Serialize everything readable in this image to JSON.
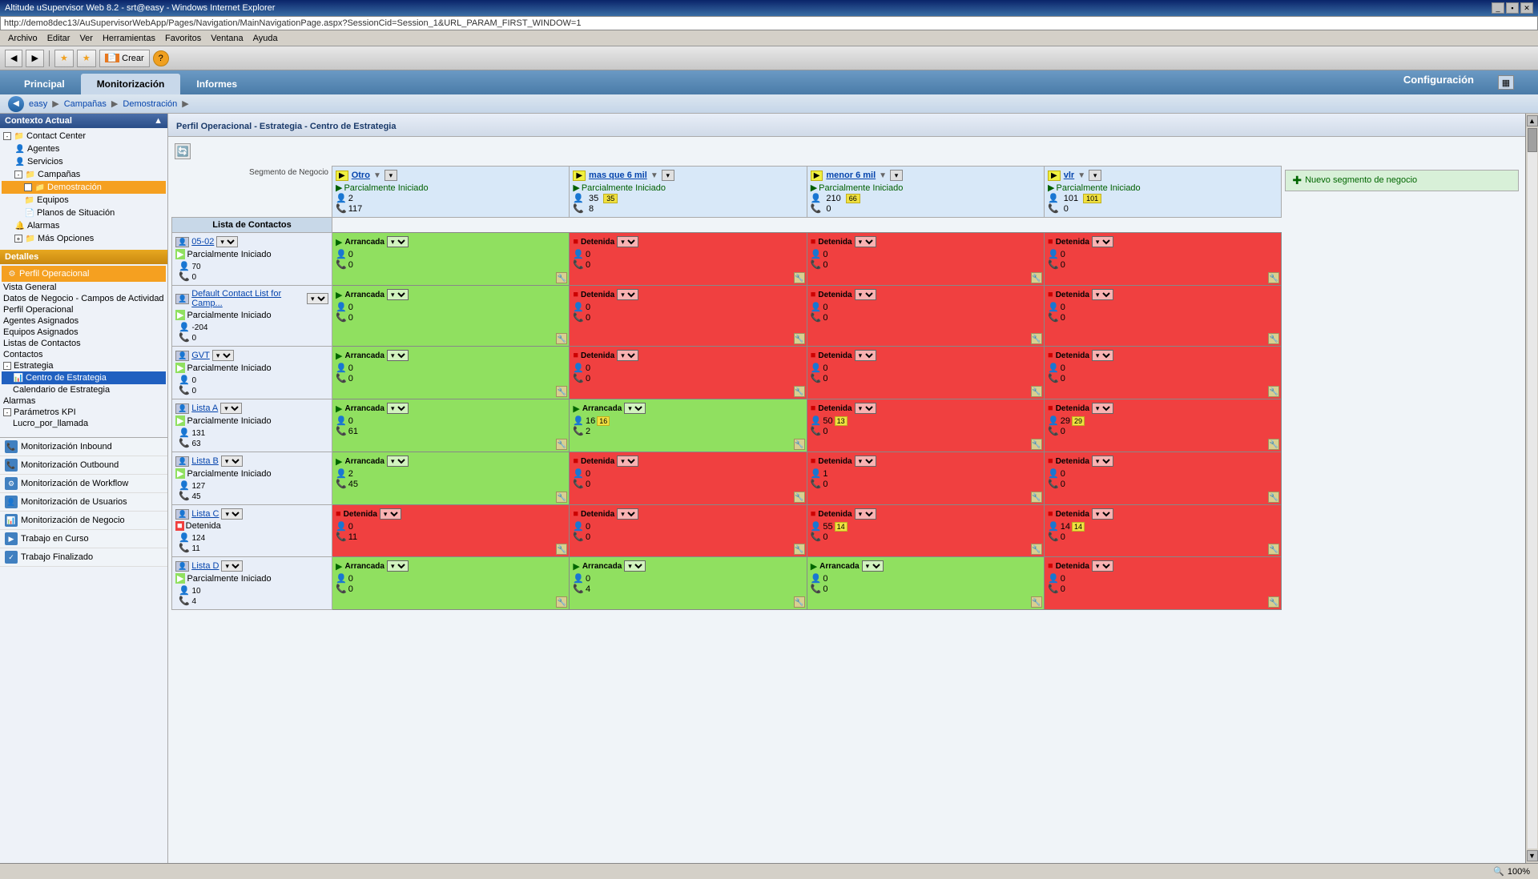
{
  "window": {
    "title": "Altitude uSupervisor Web 8.2 - srt@easy - Windows Internet Explorer",
    "url": "http://demo8dec13/AuSupervisorWebApp/Pages/Navigation/MainNavigationPage.aspx?SessionCid=Session_1&URL_PARAM_FIRST_WINDOW=1"
  },
  "menubar": {
    "items": [
      "Archivo",
      "Editar",
      "Ver",
      "Herramientas",
      "Favoritos",
      "Ventana",
      "Ayuda"
    ]
  },
  "toolbar": {
    "back_label": "◀",
    "forward_label": "▶",
    "star1": "★",
    "star2": "★",
    "create_label": "Crear"
  },
  "navtabs": {
    "tabs": [
      "Principal",
      "Monitorización",
      "Informes"
    ],
    "active": "Monitorización",
    "config_label": "Configuración"
  },
  "breadcrumb": {
    "items": [
      "easy",
      "Campañas",
      "Demostración"
    ]
  },
  "sidebar": {
    "contexto_label": "Contexto Actual",
    "tree": [
      {
        "label": "Contact Center",
        "level": 0,
        "icon": "folder",
        "expanded": true
      },
      {
        "label": "Agentes",
        "level": 1,
        "icon": "person"
      },
      {
        "label": "Servicios",
        "level": 1,
        "icon": "person"
      },
      {
        "label": "Campañas",
        "level": 1,
        "icon": "folder",
        "expanded": true
      },
      {
        "label": "Demostración",
        "level": 2,
        "icon": "folder",
        "selected": true
      },
      {
        "label": "Equipos",
        "level": 2,
        "icon": "folder"
      },
      {
        "label": "Planos de Situación",
        "level": 2,
        "icon": "doc"
      },
      {
        "label": "Alarmas",
        "level": 1,
        "icon": "alarm"
      },
      {
        "label": "Más Opciones",
        "level": 1,
        "icon": "folder"
      }
    ],
    "detalles_label": "Detalles",
    "detalles_items": [
      {
        "label": "Perfil Operacional",
        "selected": true
      },
      {
        "label": "Vista General"
      },
      {
        "label": "Datos de Negocio - Campos de Actividad"
      },
      {
        "label": "Perfil Operacional"
      },
      {
        "label": "Agentes Asignados"
      },
      {
        "label": "Equipos Asignados"
      },
      {
        "label": "Listas de Contactos"
      },
      {
        "label": "Contactos"
      },
      {
        "label": "Estrategia",
        "expanded": true
      },
      {
        "label": "Centro de Estrategia",
        "level": 1,
        "selected_blue": true
      },
      {
        "label": "Calendario de Estrategia",
        "level": 1
      },
      {
        "label": "Alarmas"
      },
      {
        "label": "Parámetros KPI",
        "expanded": true
      },
      {
        "label": "Lucro_por_llamada",
        "level": 1
      }
    ],
    "bottom_btns": [
      {
        "label": "Monitorización Inbound",
        "color": "#4080c0"
      },
      {
        "label": "Monitorización Outbound",
        "color": "#4080c0"
      },
      {
        "label": "Monitorización de Workflow",
        "color": "#4080c0"
      },
      {
        "label": "Monitorización de Usuarios",
        "color": "#4080c0"
      },
      {
        "label": "Monitorización de Negocio",
        "color": "#4080c0"
      },
      {
        "label": "Trabajo en Curso",
        "color": "#4080c0"
      },
      {
        "label": "Trabajo Finalizado",
        "color": "#4080c0"
      }
    ]
  },
  "content": {
    "title": "Perfil Operacional - Estrategia - Centro de Estrategia",
    "segment_label": "Segmento de Negocio",
    "contact_list_label": "Lista de Contactos",
    "new_segment_label": "Nuevo segmento de negocio",
    "segments": [
      {
        "name": "Otro",
        "stats": {
          "partially": "Parcialmente Iniciado",
          "v1": "2",
          "v2": "117"
        }
      },
      {
        "name": "mas que 6 mil",
        "stats": {
          "partially": "Parcialmente Iniciado",
          "v1": "35",
          "badge": "35",
          "v2": "8"
        }
      },
      {
        "name": "menor 6 mil",
        "stats": {
          "partially": "Parcialmente Iniciado",
          "v1": "210",
          "badge": "66",
          "v2": "0"
        }
      },
      {
        "name": "vlr",
        "stats": {
          "partially": "Parcialmente Iniciado",
          "v1": "101",
          "badge": "101",
          "v2": "0"
        }
      }
    ],
    "contact_lists": [
      {
        "name": "05-02",
        "status_label": "Parcialmente Iniciado",
        "stats": {
          "v1": "70",
          "v2": "0"
        },
        "cells": [
          {
            "status": "Arrancada",
            "color": "green",
            "v1": "0",
            "v2": "0"
          },
          {
            "status": "Detenida",
            "color": "red",
            "v1": "0",
            "v2": "0"
          },
          {
            "status": "Detenida",
            "color": "red",
            "v1": "0",
            "v2": "0"
          },
          {
            "status": "Detenida",
            "color": "red",
            "v1": "0",
            "v2": "0"
          }
        ]
      },
      {
        "name": "Default Contact List for Camp...",
        "status_label": "Parcialmente Iniciado",
        "stats": {
          "v1": "-204",
          "v2": "0"
        },
        "cells": [
          {
            "status": "Arrancada",
            "color": "green",
            "v1": "0",
            "v2": "0"
          },
          {
            "status": "Detenida",
            "color": "red",
            "v1": "0",
            "v2": "0"
          },
          {
            "status": "Detenida",
            "color": "red",
            "v1": "0",
            "v2": "0"
          },
          {
            "status": "Detenida",
            "color": "red",
            "v1": "0",
            "v2": "0"
          }
        ]
      },
      {
        "name": "GVT",
        "status_label": "Parcialmente Iniciado",
        "stats": {
          "v1": "0",
          "v2": "0"
        },
        "cells": [
          {
            "status": "Arrancada",
            "color": "green",
            "v1": "0",
            "v2": "0"
          },
          {
            "status": "Detenida",
            "color": "red",
            "v1": "0",
            "v2": "0"
          },
          {
            "status": "Detenida",
            "color": "red",
            "v1": "0",
            "v2": "0"
          },
          {
            "status": "Detenida",
            "color": "red",
            "v1": "0",
            "v2": "0"
          }
        ]
      },
      {
        "name": "Lista A",
        "status_label": "Parcialmente Iniciado",
        "stats": {
          "v1": "131",
          "v2": "63"
        },
        "cells": [
          {
            "status": "Arrancada",
            "color": "green",
            "v1": "0",
            "v2": "61"
          },
          {
            "status": "Arrancada",
            "color": "green",
            "v1": "16",
            "badge": "16",
            "v2": "2"
          },
          {
            "status": "Detenida",
            "color": "red",
            "v1": "50",
            "badge": "13",
            "v2": "0"
          },
          {
            "status": "Detenida",
            "color": "red",
            "v1": "29",
            "badge": "29",
            "v2": "0"
          }
        ]
      },
      {
        "name": "Lista B",
        "status_label": "Parcialmente Iniciado",
        "stats": {
          "v1": "127",
          "v2": "45"
        },
        "cells": [
          {
            "status": "Arrancada",
            "color": "green",
            "v1": "2",
            "v2": "45"
          },
          {
            "status": "Detenida",
            "color": "red",
            "v1": "0",
            "v2": "0"
          },
          {
            "status": "Detenida",
            "color": "red",
            "v1": "1",
            "v2": "0"
          },
          {
            "status": "Detenida",
            "color": "red",
            "v1": "0",
            "v2": "0"
          }
        ]
      },
      {
        "name": "Lista C",
        "status_label": "Detenida",
        "stats": {
          "v1": "124",
          "v2": "11"
        },
        "cells": [
          {
            "status": "Detenida",
            "color": "red",
            "v1": "0",
            "v2": "11"
          },
          {
            "status": "Detenida",
            "color": "red",
            "v1": "0",
            "v2": "0"
          },
          {
            "status": "Detenida",
            "color": "red",
            "v1": "55",
            "badge": "14",
            "v2": "0"
          },
          {
            "status": "Detenida",
            "color": "red",
            "v1": "14",
            "badge": "14",
            "v2": "0"
          }
        ]
      },
      {
        "name": "Lista D",
        "status_label": "Parcialmente Iniciado",
        "stats": {
          "v1": "10",
          "v2": "4"
        },
        "cells": [
          {
            "status": "Arrancada",
            "color": "green",
            "v1": "0",
            "v2": "0"
          },
          {
            "status": "Arrancada",
            "color": "green",
            "v1": "0",
            "badge": "",
            "v2": "4"
          },
          {
            "status": "Arrancada",
            "color": "green",
            "v1": "0",
            "v2": "0"
          },
          {
            "status": "Detenida",
            "color": "red",
            "v1": "0",
            "v2": "0"
          }
        ]
      }
    ]
  },
  "statusbar": {
    "zoom": "100%"
  }
}
